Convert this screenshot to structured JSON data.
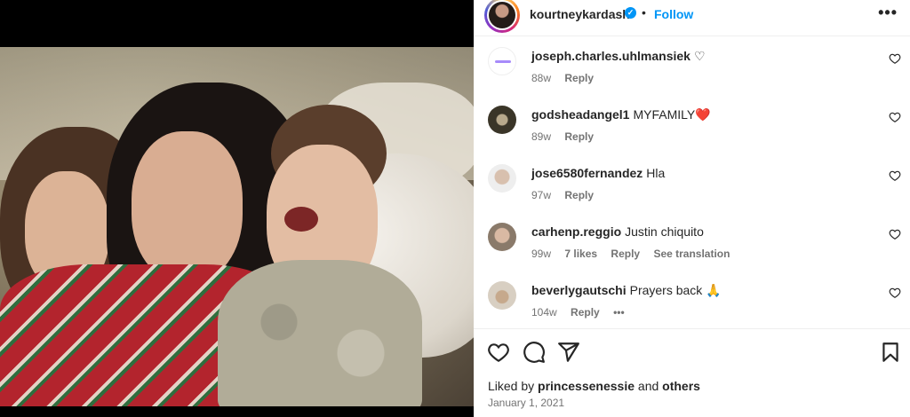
{
  "post": {
    "username": "kourtneykardash",
    "separator": "•",
    "follow_label": "Follow",
    "more_label": "•••"
  },
  "comments": [
    {
      "username": "joseph.charles.uhlmansiek",
      "text": "♡",
      "age": "88w",
      "likes": "",
      "reply": "Reply",
      "extra": ""
    },
    {
      "username": "godsheadangel1",
      "text": "MYFAMILY❤️",
      "age": "89w",
      "likes": "",
      "reply": "Reply",
      "extra": ""
    },
    {
      "username": "jose6580fernandez",
      "text": "Hla",
      "age": "97w",
      "likes": "",
      "reply": "Reply",
      "extra": ""
    },
    {
      "username": "carhenp.reggio",
      "text": "Justin chiquito",
      "age": "99w",
      "likes": "7 likes",
      "reply": "Reply",
      "extra": "See translation"
    },
    {
      "username": "beverlygautschi",
      "text": "Prayers back 🙏",
      "age": "104w",
      "likes": "",
      "reply": "Reply",
      "extra": "•••"
    }
  ],
  "footer": {
    "liked_prefix": "Liked by",
    "liked_user": "princessenessie",
    "liked_and": "and",
    "liked_others": "others",
    "date": "January 1, 2021"
  },
  "colors": {
    "accent": "#0095f6",
    "text": "#262626",
    "muted": "#737373"
  }
}
